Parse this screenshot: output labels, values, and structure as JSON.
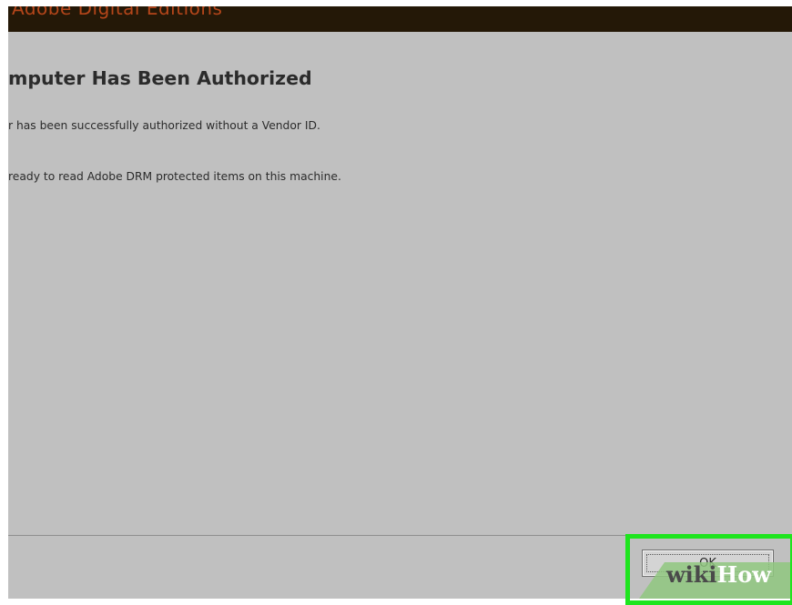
{
  "window": {
    "title": "Adobe Digital Editions"
  },
  "dialog": {
    "heading": "mputer Has Been Authorized",
    "messages": {
      "line1": "r has been successfully authorized without a Vendor ID.",
      "line2": "ready to read Adobe DRM protected items on this machine."
    },
    "ok_label": "OK"
  },
  "watermark": {
    "part1": "wiki",
    "part2": "How"
  },
  "colors": {
    "titlebar_bg": "#241807",
    "titlebar_text": "#b5461a",
    "dialog_bg": "#c0c0c0",
    "highlight": "#1ee51e",
    "watermark_band": "#8fc77f"
  }
}
